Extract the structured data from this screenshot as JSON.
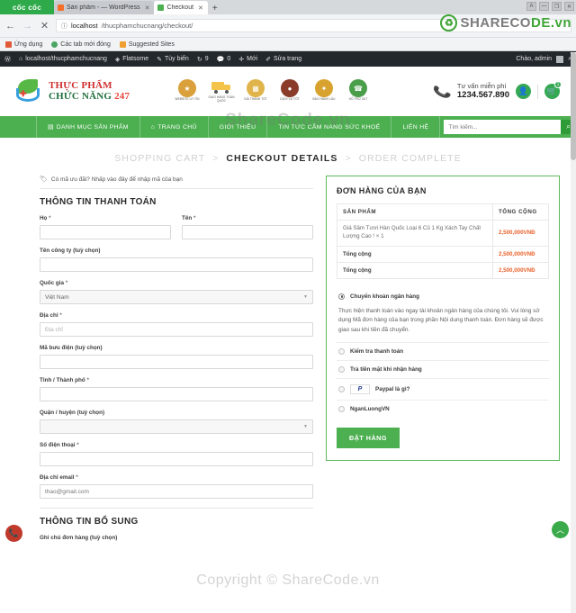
{
  "browser": {
    "brand": "cốc cốc",
    "tabs": [
      {
        "title": "Sản phẩm - — WordPress",
        "favicon": "wordpress-icon",
        "active": false
      },
      {
        "title": "Checkout",
        "favicon": "coccoc-icon",
        "active": true
      }
    ],
    "new_tab_label": "+",
    "window_controls": [
      "minimize",
      "restore",
      "maximize",
      "close"
    ],
    "back_icon": "arrow-left-icon",
    "forward_icon": "arrow-right-icon",
    "stop_icon": "close-icon",
    "url_info_icon": "info-icon",
    "url_host": "localhost",
    "url_path": "/thucphamchucnang/checkout/",
    "bookmarks": [
      {
        "label": "Ứng dụng",
        "icon": "apps-icon"
      },
      {
        "label": "Các tab mới đóng",
        "icon": "history-icon"
      },
      {
        "label": "Suggested Sites",
        "icon": "suggested-icon"
      }
    ]
  },
  "wp_adminbar": {
    "logo_icon": "wordpress-icon",
    "items": [
      {
        "label": "localhost/thucphamchucnang",
        "icon": "home-icon"
      },
      {
        "label": "Flatsome",
        "icon": "flatsome-icon"
      },
      {
        "label": "Tùy biến",
        "icon": "pencil-icon"
      },
      {
        "label": "9",
        "icon": "comment-bubble-icon"
      },
      {
        "label": "0",
        "icon": "comment-icon"
      },
      {
        "label": "Mới",
        "icon": "plus-icon"
      },
      {
        "label": "Sửa trang",
        "icon": "edit-icon"
      }
    ],
    "greeting": "Chào, admin",
    "search_icon": "search-icon"
  },
  "watermark": {
    "brand_part1": "SHARECO",
    "brand_part2": "DE.vn",
    "logo_glyph": "♻",
    "center": "ShareCode.vn",
    "bottom": "Copyright © ShareCode.vn"
  },
  "site_header": {
    "logo": {
      "line1": "THỰC PHẨM",
      "line2": "CHỨC NĂNG ",
      "line2_accent": "247"
    },
    "trust_badges": [
      {
        "label": "WEBSITE UY TÍN",
        "icon": "medal-icon",
        "color": "#d9a03c"
      },
      {
        "label": "GIAO HÀNG TOÀN QUỐC",
        "icon": "truck-icon",
        "color": "#f3c34a"
      },
      {
        "label": "GIÁ THÀNH TỐT",
        "icon": "badge-icon",
        "color": "#e0b44a"
      },
      {
        "label": "DỊCH VỤ TỐT",
        "icon": "service-icon",
        "color": "#8a3b2a"
      },
      {
        "label": "BẢO HÀNH LÂU",
        "icon": "shield-icon",
        "color": "#d8a22e"
      },
      {
        "label": "HỖ TRỢ 24/7",
        "icon": "support-icon",
        "color": "#4a9e4a"
      }
    ],
    "phone_icon": "phone-icon",
    "consult_label": "Tư vấn miễn phí",
    "phone_number": "1234.567.890",
    "account_icon": "user-icon",
    "cart_icon": "cart-icon",
    "cart_count": "1"
  },
  "site_nav": {
    "items": [
      {
        "label": "DANH MỤC SẢN PHẨM",
        "icon": "menu-icon"
      },
      {
        "label": "TRANG CHỦ",
        "icon": "home-icon"
      },
      {
        "label": "GIỚI THIỆU",
        "icon": ""
      },
      {
        "label": "TIN TỨC CẨM NANG SỨC KHOẺ",
        "icon": ""
      },
      {
        "label": "LIÊN HỆ",
        "icon": ""
      }
    ],
    "search_placeholder": "Tìm kiếm...",
    "search_value": "",
    "search_icon": "search-icon"
  },
  "steps": {
    "step1": "SHOPPING CART",
    "sep": ">",
    "step2": "CHECKOUT DETAILS",
    "step3": "ORDER COMPLETE"
  },
  "billing": {
    "coupon_note": "Có mã ưu đãi? Nhấp vào đây để nhập mã của bạn",
    "coupon_icon": "tag-icon",
    "section_title": "THÔNG TIN THANH TOÁN",
    "fields": [
      {
        "label": "Họ",
        "required": "*",
        "value": "",
        "placeholder": "",
        "type": "text"
      },
      {
        "label": "Tên",
        "required": "*",
        "value": "",
        "placeholder": "",
        "type": "text"
      },
      {
        "label": "Tên công ty (tuỳ chọn)",
        "required": "",
        "value": "",
        "placeholder": "",
        "type": "text"
      },
      {
        "label": "Quốc gia",
        "required": "*",
        "value": "Việt Nam",
        "placeholder": "",
        "type": "select"
      },
      {
        "label": "Địa chỉ",
        "required": "*",
        "value": "",
        "placeholder": "Địa chỉ",
        "type": "text"
      },
      {
        "label": "Mã bưu điện (tuỳ chọn)",
        "required": "",
        "value": "",
        "placeholder": "",
        "type": "text"
      },
      {
        "label": "Tỉnh / Thành phố",
        "required": "*",
        "value": "",
        "placeholder": "",
        "type": "text"
      },
      {
        "label": "Quận / huyện (tuỳ chọn)",
        "required": "",
        "value": "",
        "placeholder": "",
        "type": "select"
      },
      {
        "label": "Số điện thoại",
        "required": "*",
        "value": "",
        "placeholder": "",
        "type": "text"
      },
      {
        "label": "Địa chỉ email",
        "required": "*",
        "value": "thao@gmail.com",
        "placeholder": "",
        "type": "text"
      }
    ],
    "extra_title": "THÔNG TIN BỔ SUNG",
    "extra_label": "Ghi chú đơn hàng (tuỳ chọn)"
  },
  "order": {
    "title": "ĐƠN HÀNG CỦA BẠN",
    "columns": [
      "SẢN PHẨM",
      "TỔNG CỘNG"
    ],
    "rows": [
      {
        "name": "Giá Sâm Tươi Hàn Quốc Loại 6 Củ 1 Kg Xách Tay Chất Lượng Cao ! × 1",
        "amount": "2,500,000VNĐ",
        "bold": false
      },
      {
        "name": "Tổng cộng",
        "amount": "2,500,000VNĐ",
        "bold": true
      },
      {
        "name": "Tổng cộng",
        "amount": "2,500,000VNĐ",
        "bold": true
      }
    ],
    "payments": [
      {
        "label": "Chuyển khoản ngân hàng",
        "selected": true,
        "logo": ""
      },
      {
        "label": "Kiểm tra thanh toán",
        "selected": false,
        "logo": ""
      },
      {
        "label": "Trả tiền mặt khi nhận hàng",
        "selected": false,
        "logo": ""
      },
      {
        "label": "Paypal là gì?",
        "selected": false,
        "logo": "paypal-logo"
      },
      {
        "label": "NganLuongVN",
        "selected": false,
        "logo": ""
      }
    ],
    "bank_description": "Thực hiện thanh toán vào ngay tài khoản ngân hàng của chúng tôi. Vui lòng sử dụng Mã đơn hàng của bạn trong phần Nội dung thanh toán. Đơn hàng sẽ được giao sau khi tiền đã chuyển.",
    "submit_label": "ĐẶT HÀNG"
  },
  "floating": {
    "call_icon": "phone-icon",
    "back_to_top_icon": "chevron-up-icon"
  },
  "colors": {
    "brand_green": "#4caf50",
    "price_orange": "#e8622c",
    "wp_dark": "#23282d"
  }
}
